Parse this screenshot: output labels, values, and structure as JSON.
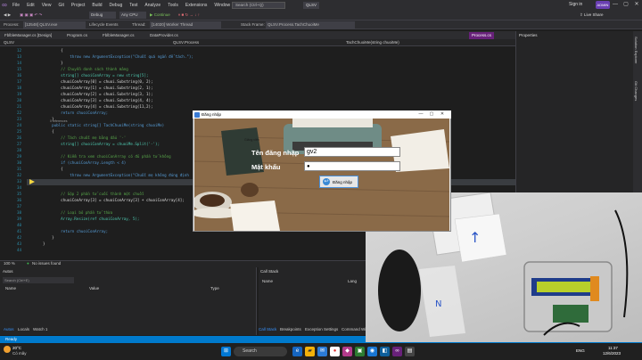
{
  "menubar": {
    "items": [
      "File",
      "Edit",
      "View",
      "Git",
      "Project",
      "Build",
      "Debug",
      "Test",
      "Analyze",
      "Tools",
      "Extensions",
      "Window",
      "Help"
    ],
    "search_placeholder": "Search (Ctrl+Q)",
    "solution_name": "QLSV",
    "signin": "Sign in",
    "avatar": "ADMIN"
  },
  "toolbar": {
    "config": "Debug",
    "platform": "Any CPU",
    "continue_label": "Continue",
    "live_share": "Live Share"
  },
  "toolbar2": {
    "process_label": "Process:",
    "process_value": "[12548] QLSV.exe",
    "lifecycle_label": "Lifecycle Events",
    "thread_label": "Thread:",
    "thread_value": "[14020] Worker Thread",
    "stack_label": "Stack Frame:",
    "stack_value": "QLSV.Process.TachChuoiMe"
  },
  "doc_tabs": [
    "FblbleManager.cs [Design]",
    "Program.cs",
    "FblbleManager.cs",
    "DataProvider.cs",
    "Process.cs"
  ],
  "nav": {
    "project": "QLSV",
    "class": "QLSV.Process",
    "member": "TachChuoiMe(string chuoiMe)"
  },
  "code_lines": [
    {
      "n": "12",
      "t": "        {"
    },
    {
      "n": "13",
      "t": "            throw new ArgumentException(\"Chuỗi quá ngắn để tách.\");"
    },
    {
      "n": "14",
      "t": "        }"
    },
    {
      "n": "15",
      "t": "        // Chuyển danh sách thành mảng"
    },
    {
      "n": "16",
      "t": "        string[] chuoiConArray = new string[5];"
    },
    {
      "n": "17",
      "t": "        chuoiConArray[0] = chuoi.Substring(0, 2);"
    },
    {
      "n": "18",
      "t": "        chuoiConArray[1] = chuoi.Substring(2, 1);"
    },
    {
      "n": "19",
      "t": "        chuoiConArray[2] = chuoi.Substring(3, 1);"
    },
    {
      "n": "20",
      "t": "        chuoiConArray[3] = chuoi.Substring(4, 4);"
    },
    {
      "n": "21",
      "t": "        chuoiConArray[4] = chuoi.Substring(11,2);"
    },
    {
      "n": "22",
      "t": "        return chuoiConArray;"
    },
    {
      "n": "23",
      "t": "    }"
    },
    {
      "n": "24",
      "t": "    public static string[] TachChuoiMe(string chuoiMe)"
    },
    {
      "n": "25",
      "t": "    {"
    },
    {
      "n": "26",
      "t": "        // Tách chuỗi mẹ bằng dấu '-'"
    },
    {
      "n": "27",
      "t": "        string[] chuoiConArray = chuoiMe.Split('-');"
    },
    {
      "n": "28",
      "t": ""
    },
    {
      "n": "29",
      "t": "        // Kiểm tra xem chuoiConArray có đủ phần tử không"
    },
    {
      "n": "30",
      "t": "        if (chuoiConArray.Length < 4)"
    },
    {
      "n": "31",
      "t": "        {"
    },
    {
      "n": "32",
      "t": "            throw new ArgumentException(\"Chuỗi mẹ không đúng định"
    },
    {
      "n": "33",
      "t": "        }"
    },
    {
      "n": "34",
      "t": ""
    },
    {
      "n": "35",
      "t": "        // Gộp 2 phần tử cuối thành một chuỗi"
    },
    {
      "n": "36",
      "t": "        chuoiConArray[3] = chuoiConArray[3] + chuoiConArray[4];"
    },
    {
      "n": "37",
      "t": ""
    },
    {
      "n": "38",
      "t": "        // Loại bỏ phần tử thừa"
    },
    {
      "n": "39",
      "t": "        Array.Resize(ref chuoiConArray, 5);"
    },
    {
      "n": "40",
      "t": ""
    },
    {
      "n": "41",
      "t": "        return chuoiConArray;"
    },
    {
      "n": "42",
      "t": "    }"
    },
    {
      "n": "43",
      "t": "}"
    },
    {
      "n": "44",
      "t": ""
    }
  ],
  "references_label": "0 references",
  "editor_status": {
    "zoom": "100 %",
    "issues": "No issues found",
    "line": "Ln: 36",
    "ch": "Ch: 9",
    "spc": "SPC",
    "crlf": "CRLF"
  },
  "autos": {
    "title": "Autos",
    "search": "Search (Ctrl+E)",
    "col_name": "Name",
    "col_value": "Value",
    "col_type": "Type"
  },
  "callstack": {
    "title": "Call Stack",
    "col_name": "Name",
    "col_lang": "Lang"
  },
  "bottom_tabs_left": [
    "Autos",
    "Locals",
    "Watch 1"
  ],
  "bottom_tabs_right": [
    "Call Stack",
    "Breakpoints",
    "Exception Settings",
    "Command Wi"
  ],
  "statusbar": "Ready",
  "properties": {
    "title": "Properties",
    "side_tabs": [
      "Solution Explorer",
      "Git Changes"
    ]
  },
  "dialog": {
    "title": "Đăng nhập",
    "username_label": "Tên đăng nhập",
    "username_value": "gv2",
    "password_label": "Mật khẩu",
    "password_value": "●",
    "login_button": "Đăng nhập",
    "small_label": "Giảng viên"
  },
  "taskbar": {
    "weather_temp": "20°C",
    "weather_desc": "Có mây",
    "search_placeholder": "Search",
    "lang": "ENG",
    "time": "11:37",
    "date": "12/6/2023"
  },
  "colors": {
    "accent": "#68217a",
    "statusbar": "#007acc",
    "keyword": "#569cd6",
    "type": "#4ec9b0",
    "string": "#d69d85",
    "comment": "#57a64a",
    "number": "#b5cea8"
  }
}
